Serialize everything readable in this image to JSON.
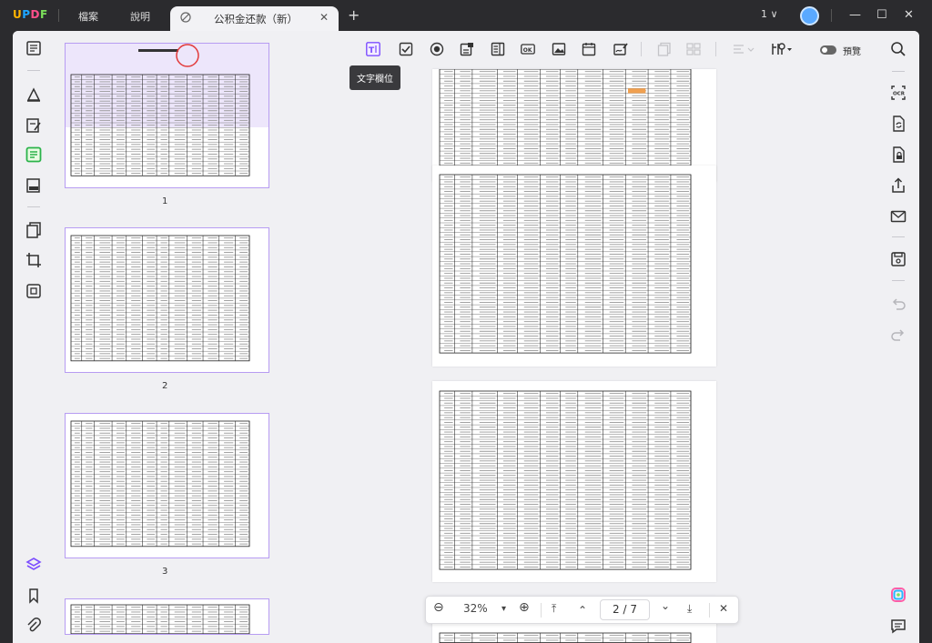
{
  "app": {
    "logo": {
      "l1": "U",
      "l2": "P",
      "l3": "D",
      "l4": "F"
    },
    "menu": [
      "檔案",
      "說明"
    ],
    "tab": {
      "title": "公积金还款（新）",
      "close": "✕"
    },
    "new_tab": "+",
    "page_selector": "1 ∨",
    "window": {
      "minimize": "—",
      "maximize": "☐",
      "close": "✕"
    }
  },
  "toolbar": {
    "tooltip": "文字欄位",
    "preview_label": "預覽",
    "tools": [
      "text-field",
      "checkbox",
      "radio-button",
      "combo-box",
      "list-box",
      "button",
      "image-field",
      "date-field",
      "signature-field"
    ]
  },
  "thumbnails": [
    {
      "label": "1"
    },
    {
      "label": "2"
    },
    {
      "label": "3"
    }
  ],
  "zoom": {
    "zoom_out": "⊖",
    "value": "32%",
    "dropdown": "▾",
    "zoom_in": "⊕",
    "first": "⤒",
    "prev": "⌃",
    "page_indicator": "2 / 7",
    "next": "⌄",
    "last": "⤓",
    "close": "✕"
  },
  "colors": {
    "accent": "#7c4dff",
    "selection": "#b79cf2",
    "dark": "#2b2b2e",
    "panel": "#f0f0f3"
  }
}
